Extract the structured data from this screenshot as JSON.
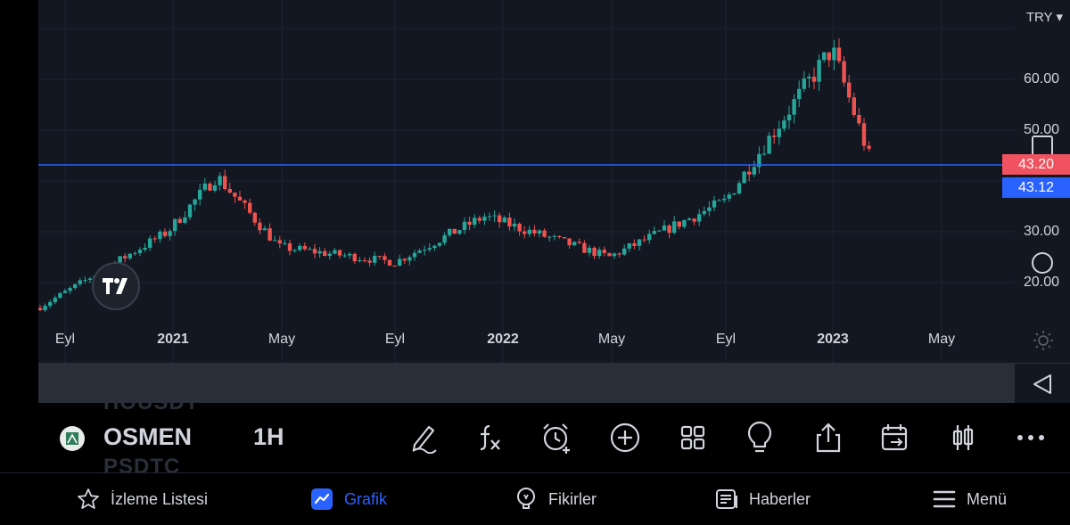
{
  "chart": {
    "symbol": "OSMEN",
    "interval": "1H",
    "ghost_symbol_above": "HOUSDT",
    "ghost_symbol_below": "PSDTC",
    "currency": "TRY",
    "x_axis_labels": [
      {
        "text": "Eyl",
        "bold": false
      },
      {
        "text": "2021",
        "bold": true
      },
      {
        "text": "May",
        "bold": false
      },
      {
        "text": "Eyl",
        "bold": false
      },
      {
        "text": "2022",
        "bold": true
      },
      {
        "text": "May",
        "bold": false
      },
      {
        "text": "Eyl",
        "bold": false
      },
      {
        "text": "2023",
        "bold": true
      },
      {
        "text": "May",
        "bold": false
      }
    ],
    "y_axis_labels": [
      "60.00",
      "50.00",
      "30.00",
      "20.00"
    ],
    "last_price": "43.20",
    "last_price_color": "#f0525f",
    "line_price": "43.12",
    "line_color": "#2962ff",
    "up_color": "#26a69a",
    "down_color": "#ef5350",
    "background": "#131722"
  },
  "chart_data": {
    "type": "candlestick",
    "y_ticks": [
      20,
      30,
      50,
      60
    ],
    "horizontal_line": 43.12,
    "last_close": 43.2,
    "approx_trend": [
      {
        "period": "Eyl 2020",
        "price": 15
      },
      {
        "period": "2021",
        "price": 30
      },
      {
        "period": "Mar 2021",
        "price": 41
      },
      {
        "period": "May 2021",
        "price": 27
      },
      {
        "period": "Eyl 2021",
        "price": 24
      },
      {
        "period": "2022",
        "price": 33
      },
      {
        "period": "May 2022",
        "price": 25
      },
      {
        "period": "Eyl 2022",
        "price": 36
      },
      {
        "period": "Dec 2022",
        "price": 66
      },
      {
        "period": "Feb 2023",
        "price": 43.2
      }
    ]
  },
  "toolbar": {
    "tools": [
      "drawing-tool-icon",
      "indicators-fx-icon",
      "alert-clock-icon",
      "add-circle-icon",
      "layouts-grid-icon",
      "ideas-lightbulb-icon",
      "share-upload-icon",
      "replay-calendar-icon",
      "chart-type-candles-icon",
      "more-dots-icon"
    ]
  },
  "nav": {
    "watchlist": "İzleme Listesi",
    "chart": "Grafik",
    "ideas": "Fikirler",
    "news": "Haberler",
    "menu": "Menü"
  }
}
